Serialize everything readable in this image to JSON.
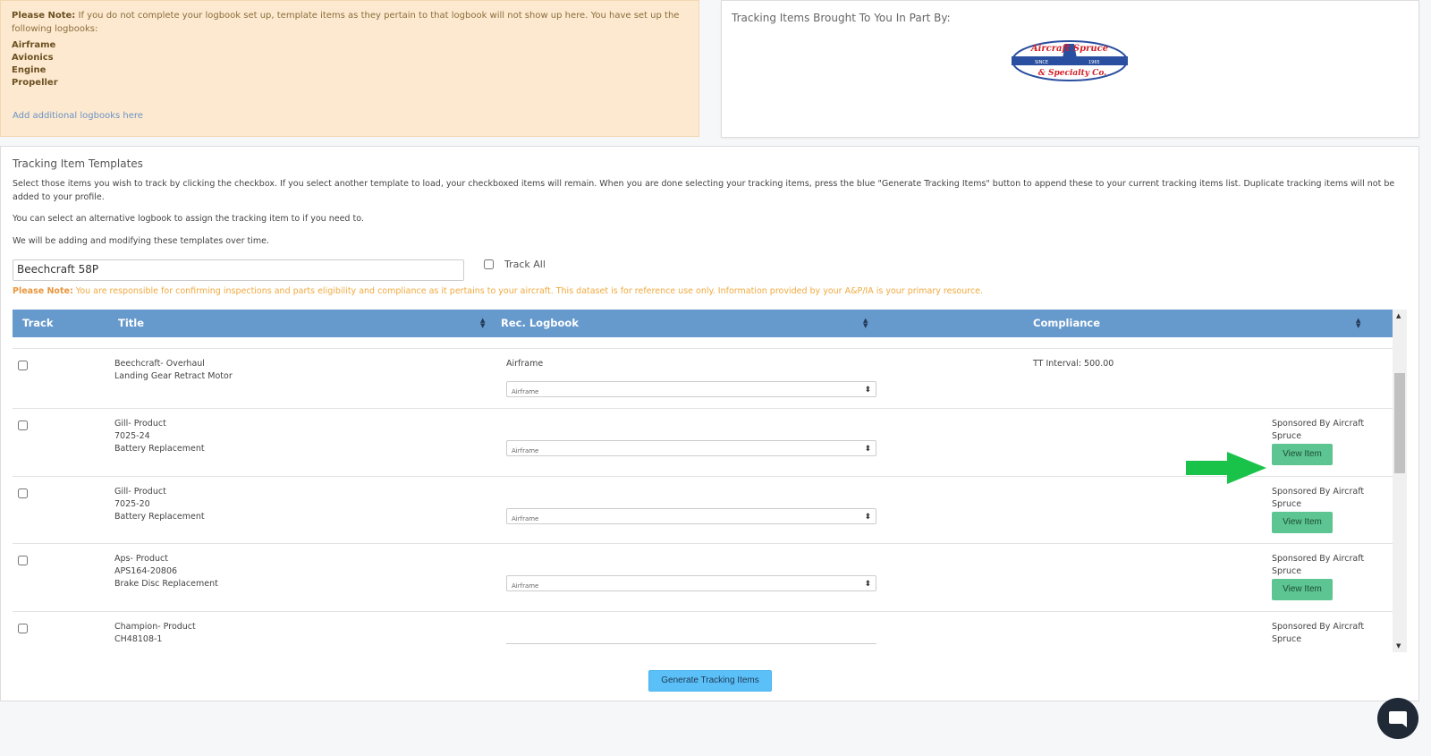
{
  "note": {
    "label": "Please Note:",
    "text": "If you do not complete your logbook set up, template items as they pertain to that logbook will not show up here. You have set up the following logbooks:",
    "logbooks": [
      "Airframe",
      "Avionics",
      "Engine",
      "Propeller"
    ],
    "add_link": "Add additional logbooks here"
  },
  "sponsor": {
    "title": "Tracking Items Brought To You In Part By:",
    "logo_line1": "Aircraft Spruce",
    "logo_since": "SINCE",
    "logo_year": "1965",
    "logo_line2": "& Specialty Co."
  },
  "templates": {
    "title": "Tracking Item Templates",
    "desc1": "Select those items you wish to track by clicking the checkbox. If you select another template to load, your checkboxed items will remain. When you are done selecting your tracking items, press the blue \"Generate Tracking Items\" button to append these to your current tracking items list. Duplicate tracking items will not be added to your profile.",
    "desc2": "You can select an alternative logbook to assign the tracking item to if you need to.",
    "desc3": "We will be adding and modifying these templates over time.",
    "selected_template": "Beechcraft 58P",
    "track_all_label": "Track All",
    "warning_label": "Please Note:",
    "warning_text": "You are responsible for confirming inspections and parts eligibility and compliance as it pertains to your aircraft. This dataset is for reference use only. Information provided by your A&P/IA is your primary resource.",
    "generate_label": "Generate Tracking Items"
  },
  "table": {
    "headers": {
      "track": "Track",
      "title": "Title",
      "logbook": "Rec. Logbook",
      "compliance": "Compliance"
    },
    "rows": [
      {
        "line1": "Beechcraft- Overhaul",
        "line2": "Landing Gear Retract Motor",
        "line3": "",
        "logbook_text": "Airframe",
        "logbook_select": "Airframe",
        "compliance": "TT Interval: 500.00",
        "sponsored": "",
        "view": ""
      },
      {
        "line1": "Gill- Product",
        "line2": "7025-24",
        "line3": "Battery Replacement",
        "logbook_text": "",
        "logbook_select": "Airframe",
        "compliance": "",
        "sponsored": "Sponsored By Aircraft Spruce",
        "view": "View Item"
      },
      {
        "line1": "Gill- Product",
        "line2": "7025-20",
        "line3": "Battery Replacement",
        "logbook_text": "",
        "logbook_select": "Airframe",
        "compliance": "",
        "sponsored": "Sponsored By Aircraft Spruce",
        "view": "View Item"
      },
      {
        "line1": "Aps- Product",
        "line2": "APS164-20806",
        "line3": "Brake Disc Replacement",
        "logbook_text": "",
        "logbook_select": "Airframe",
        "compliance": "",
        "sponsored": "Sponsored By Aircraft Spruce",
        "view": "View Item"
      },
      {
        "line1": "Champion- Product",
        "line2": "CH48108-1",
        "line3": "",
        "logbook_text": "",
        "logbook_select": "",
        "compliance": "",
        "sponsored": "Sponsored By Aircraft Spruce",
        "view": ""
      }
    ]
  },
  "icons": {
    "sort": "sort-icon",
    "select_caret": "chevron-updown-icon",
    "arrow": "green-arrow-icon",
    "chat": "chat-icon"
  },
  "colors": {
    "header": "#6699cc",
    "view_button": "#5cc591",
    "generate_button": "#5bc0f8",
    "arrow": "#19c34a",
    "note_bg": "#fde9cf",
    "warning": "#f0a93f"
  }
}
